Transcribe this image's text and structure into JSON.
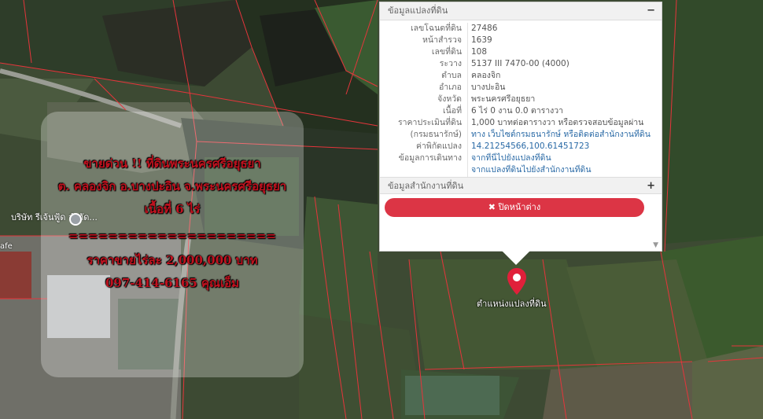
{
  "ad": {
    "line1": "ขายด่วน !! ที่ดินพระนครศรีอยุธยา",
    "line2": "ต. คลองจิก อ.บางปะอิน จ.พระนครศรีอยุธยา",
    "line3": "เนื้อที่ 6 ไร่",
    "separator": "=====================",
    "line4": "ราคาขายไร่ละ 2,000,000 บาท",
    "line5": "097-414-6165 คุณเอ็ม"
  },
  "map": {
    "poi_label": "บริษัท รีเจ้นฟู้ด จำกัด...",
    "edge_label": "afe",
    "marker_label": "ตำแหน่งแปลงที่ดิน"
  },
  "panel": {
    "header": "ข้อมูลแปลงที่ดิน",
    "header_toggle": "−",
    "rows": [
      {
        "key": "เลขโฉนดที่ดิน",
        "value": "27486"
      },
      {
        "key": "หน้าสำรวจ",
        "value": "1639"
      },
      {
        "key": "เลขที่ดิน",
        "value": "108"
      },
      {
        "key": "ระวาง",
        "value": "5137 III 7470-00 (4000)"
      },
      {
        "key": "ตำบล",
        "value": "คลองจิก"
      },
      {
        "key": "อำเภอ",
        "value": "บางปะอิน"
      },
      {
        "key": "จังหวัด",
        "value": "พระนครศรีอยุธยา"
      },
      {
        "key": "เนื้อที่",
        "value": "6 ไร่ 0 งาน 0.0 ตารางวา"
      },
      {
        "key": "ราคาประเมินที่ดิน",
        "value": "1,000 บาทต่อตารางวา หรือตรวจสอบข้อมูลผ่าน"
      },
      {
        "key": "(กรมธนารักษ์)",
        "value": "ทาง เว็บไซต์กรมธนารักษ์ หรือติดต่อสำนักงานที่ดิน"
      },
      {
        "key": "ค่าพิกัดแปลง",
        "value": "14.21254566,100.61451723"
      },
      {
        "key": "ข้อมูลการเดินทาง",
        "value": "จากที่นี่ไปยังแปลงที่ดิน"
      },
      {
        "key": "",
        "value": "จากแปลงที่ดินไปยังสำนักงานที่ดิน"
      }
    ],
    "office_header": "ข้อมูลสำนักงานที่ดิน",
    "office_toggle": "+",
    "close_label": "✖ ปิดหน้าต่าง",
    "scroll_down": "▼"
  },
  "colors": {
    "close_button": "#dc3545",
    "link": "#2a6aa6",
    "ad_text": "#c1121f",
    "marker": "#e0203a",
    "parcel_lines": "#e5353b"
  }
}
